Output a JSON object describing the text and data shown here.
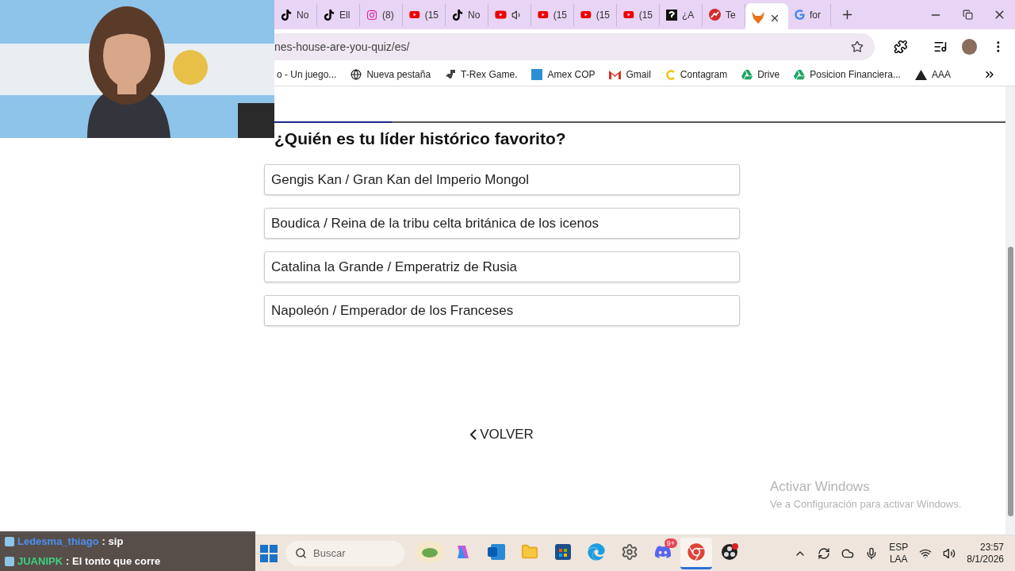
{
  "tabs": [
    {
      "label": "No",
      "kind": "tiktok",
      "audio": false,
      "selected": false
    },
    {
      "label": "Ell",
      "kind": "tiktok",
      "audio": false,
      "selected": false
    },
    {
      "label": "(8)",
      "kind": "instagram",
      "audio": false,
      "selected": false
    },
    {
      "label": "(15",
      "kind": "youtube",
      "audio": false,
      "selected": false
    },
    {
      "label": "No",
      "kind": "tiktok",
      "audio": false,
      "selected": false
    },
    {
      "kind": "youtube",
      "audio": true,
      "selected": false
    },
    {
      "label": "(15",
      "kind": "youtube",
      "audio": false,
      "selected": false
    },
    {
      "label": "(15",
      "kind": "youtube",
      "audio": false,
      "selected": false
    },
    {
      "label": "(15",
      "kind": "youtube",
      "audio": false,
      "selected": false
    },
    {
      "label": "¿A",
      "kind": "question",
      "audio": false,
      "selected": false
    },
    {
      "label": "Te",
      "kind": "chart",
      "audio": false,
      "selected": false
    },
    {
      "kind": "fox",
      "audio": false,
      "selected": true
    },
    {
      "label": "for",
      "kind": "google",
      "audio": false,
      "selected": false
    }
  ],
  "address": {
    "url": "nes-house-are-you-quiz/es/"
  },
  "bookmarks": [
    {
      "label": "o - Un juego...",
      "kind": "plain"
    },
    {
      "label": "Nueva pestaña",
      "kind": "globe"
    },
    {
      "label": "T-Rex Game.",
      "kind": "dino"
    },
    {
      "label": "Amex COP",
      "kind": "square"
    },
    {
      "label": "Gmail",
      "kind": "gmail"
    },
    {
      "label": "Contagram",
      "kind": "c"
    },
    {
      "label": "Drive",
      "kind": "drive"
    },
    {
      "label": "Posicion Financiera...",
      "kind": "drive"
    },
    {
      "label": "AAA",
      "kind": "triangle"
    }
  ],
  "quiz": {
    "progress": {
      "level": 0.16
    },
    "question": "¿Quién es tu líder histórico favorito?",
    "options": [
      "Gengis Kan / Gran Kan del Imperio Mongol",
      "Boudica / Reina de la tribu celta británica de los icenos",
      "Catalina la Grande / Emperatriz de Rusia",
      "Napoleón / Emperador de los Franceses"
    ],
    "back": "VOLVER"
  },
  "activation": {
    "title": "Activar Windows",
    "text": "Ve a Configuración para activar Windows."
  },
  "chat": [
    {
      "user": "Ledesma_thiago",
      "message": ": sip",
      "color": "#4d8ff0"
    },
    {
      "user": "JUANIPK",
      "message": ": El tonto que corre",
      "color": "#3fd27f"
    }
  ],
  "taskbar": {
    "search_placeholder": "Buscar",
    "apps": [
      {
        "kind": "widget",
        "selected": false
      },
      {
        "kind": "copilot",
        "selected": false
      },
      {
        "kind": "outlook",
        "selected": false
      },
      {
        "kind": "folder",
        "selected": false
      },
      {
        "kind": "store",
        "selected": false
      },
      {
        "kind": "edge",
        "selected": false
      },
      {
        "kind": "settings",
        "selected": false
      },
      {
        "kind": "discord",
        "badge": "9+",
        "selected": false
      },
      {
        "kind": "chrome",
        "selected": true
      },
      {
        "kind": "obs",
        "selected": false
      }
    ],
    "tray": {
      "language": "ESP",
      "layout": "LAA",
      "time": "23:57",
      "date": "8/1/2026"
    }
  }
}
